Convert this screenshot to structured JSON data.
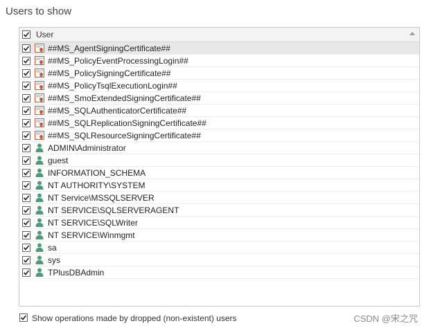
{
  "section_title": "Users to show",
  "grid": {
    "header": {
      "label": "User",
      "checked": true
    },
    "rows": [
      {
        "label": "##MS_AgentSigningCertificate##",
        "type": "certificate",
        "checked": true,
        "selected": true
      },
      {
        "label": "##MS_PolicyEventProcessingLogin##",
        "type": "certificate",
        "checked": true
      },
      {
        "label": "##MS_PolicySigningCertificate##",
        "type": "certificate",
        "checked": true
      },
      {
        "label": "##MS_PolicyTsqlExecutionLogin##",
        "type": "certificate",
        "checked": true
      },
      {
        "label": "##MS_SmoExtendedSigningCertificate##",
        "type": "certificate",
        "checked": true
      },
      {
        "label": "##MS_SQLAuthenticatorCertificate##",
        "type": "certificate",
        "checked": true
      },
      {
        "label": "##MS_SQLReplicationSigningCertificate##",
        "type": "certificate",
        "checked": true
      },
      {
        "label": "##MS_SQLResourceSigningCertificate##",
        "type": "certificate",
        "checked": true
      },
      {
        "label": "ADMIN\\Administrator",
        "type": "user",
        "checked": true
      },
      {
        "label": "guest",
        "type": "user",
        "checked": true
      },
      {
        "label": "INFORMATION_SCHEMA",
        "type": "user",
        "checked": true
      },
      {
        "label": "NT AUTHORITY\\SYSTEM",
        "type": "user",
        "checked": true
      },
      {
        "label": "NT Service\\MSSQLSERVER",
        "type": "user",
        "checked": true
      },
      {
        "label": "NT SERVICE\\SQLSERVERAGENT",
        "type": "user",
        "checked": true
      },
      {
        "label": "NT SERVICE\\SQLWriter",
        "type": "user",
        "checked": true
      },
      {
        "label": "NT SERVICE\\Winmgmt",
        "type": "user",
        "checked": true
      },
      {
        "label": "sa",
        "type": "user",
        "checked": true
      },
      {
        "label": "sys",
        "type": "user",
        "checked": true
      },
      {
        "label": "TPlusDBAdmin",
        "type": "user",
        "checked": true
      }
    ]
  },
  "footer": {
    "label": "Show operations made by dropped (non-existent) users",
    "checked": true
  },
  "watermark": "CSDN @宋之咒",
  "colors": {
    "user_icon": "#4f9a7b",
    "certificate_icon_border": "#d4562a",
    "selected_row": "#e8e8e8"
  }
}
